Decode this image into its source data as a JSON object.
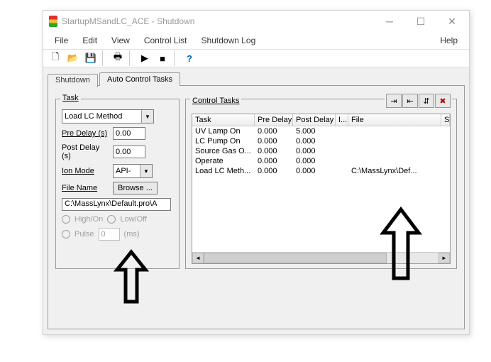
{
  "window": {
    "title": "StartupMSandLC_ACE - Shutdown"
  },
  "menu": {
    "file": "File",
    "edit": "Edit",
    "view": "View",
    "control_list": "Control List",
    "shutdown_log": "Shutdown Log",
    "help": "Help"
  },
  "tabs": {
    "shutdown": "Shutdown",
    "auto": "Auto Control Tasks"
  },
  "task_panel": {
    "legend": "Task",
    "method_dropdown": "Load LC Method",
    "pre_delay_label": "Pre Delay (s)",
    "pre_delay_value": "0.00",
    "post_delay_label": "Post Delay (s)",
    "post_delay_value": "0.00",
    "ion_mode_label": "Ion Mode",
    "ion_mode_value": "API-",
    "file_name_label": "File Name",
    "browse_label": "Browse ...",
    "file_name_value": "C:\\MassLynx\\Default.pro\\A",
    "radio_high": "High/On",
    "radio_low": "Low/Off",
    "radio_pulse": "Pulse",
    "pulse_value": "0",
    "pulse_unit": "(ms)"
  },
  "control_tasks": {
    "legend": "Control Tasks",
    "headers": {
      "task": "Task",
      "pre": "Pre Delay",
      "post": "Post Delay",
      "i": "I...",
      "file": "File",
      "s": "S"
    },
    "rows": [
      {
        "task": "UV Lamp On",
        "pre": "0.000",
        "post": "5.000",
        "i": "",
        "file": ""
      },
      {
        "task": "LC Pump On",
        "pre": "0.000",
        "post": "0.000",
        "i": "",
        "file": ""
      },
      {
        "task": "Source Gas O...",
        "pre": "0.000",
        "post": "0.000",
        "i": "",
        "file": ""
      },
      {
        "task": "Operate",
        "pre": "0.000",
        "post": "0.000",
        "i": "",
        "file": ""
      },
      {
        "task": "Load LC Meth...",
        "pre": "0.000",
        "post": "0.000",
        "i": "",
        "file": "C:\\MassLynx\\Def..."
      }
    ]
  }
}
